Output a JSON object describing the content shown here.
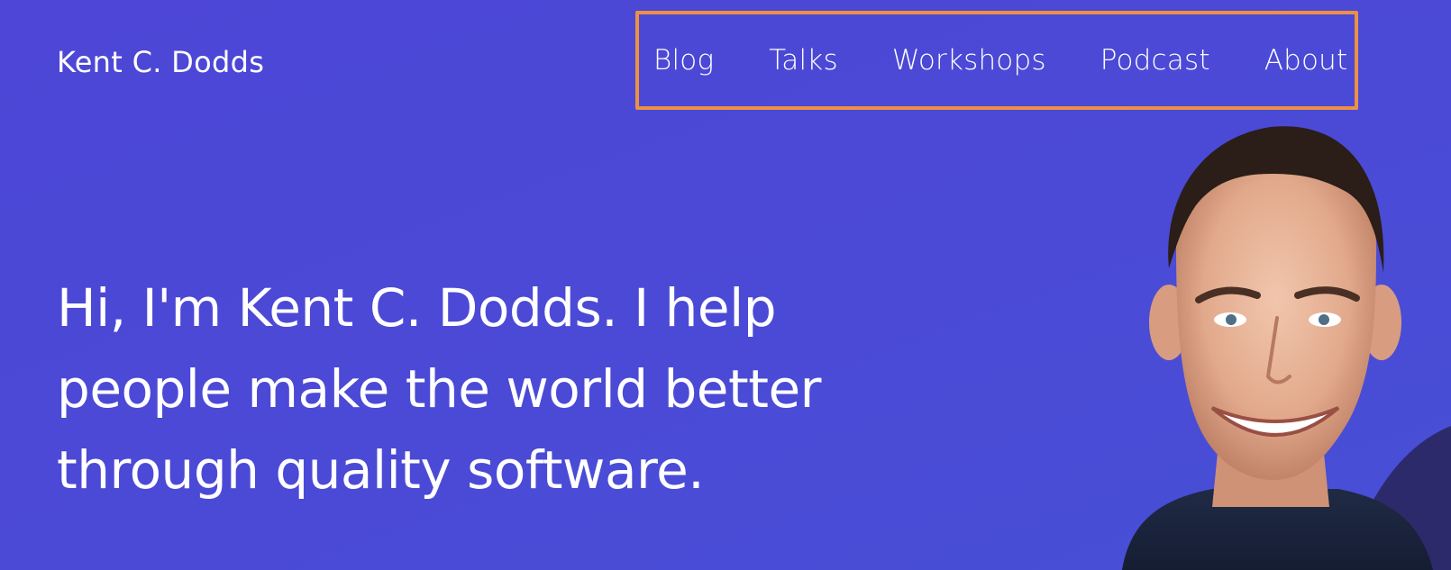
{
  "header": {
    "site_title": "Kent C. Dodds"
  },
  "nav": {
    "items": [
      {
        "label": "Blog"
      },
      {
        "label": "Talks"
      },
      {
        "label": "Workshops"
      },
      {
        "label": "Podcast"
      },
      {
        "label": "About"
      }
    ],
    "highlight_color": "#ec9144"
  },
  "hero": {
    "heading": "Hi, I'm Kent C. Dodds. I help people make the world better through quality software."
  },
  "colors": {
    "background": "#4b48d6",
    "text": "#ffffff",
    "accent_shape": "#2c2a6b"
  },
  "images": {
    "portrait": "portrait-photo"
  }
}
